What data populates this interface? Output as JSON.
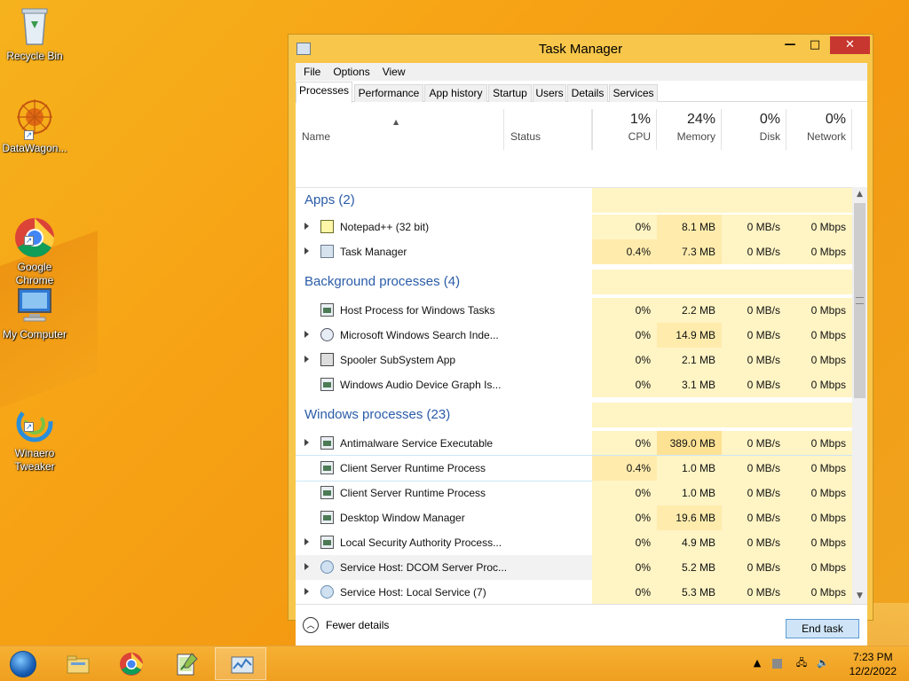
{
  "desktop": {
    "icons": [
      {
        "label": "Recycle Bin",
        "icon": "recycle-bin-icon"
      },
      {
        "label": "DataWagon...",
        "icon": "datawagon-icon"
      },
      {
        "label": "Google\nChrome",
        "icon": "chrome-icon"
      },
      {
        "label": "My Computer",
        "icon": "computer-icon"
      },
      {
        "label": "Winaero\nTweaker",
        "icon": "winaero-icon"
      }
    ]
  },
  "window": {
    "title": "Task Manager",
    "controls": {
      "minimize": "—",
      "maximize": "□",
      "close": "✕"
    },
    "menu": [
      "File",
      "Options",
      "View"
    ],
    "tabs": [
      "Processes",
      "Performance",
      "App history",
      "Startup",
      "Users",
      "Details",
      "Services"
    ],
    "active_tab": "Processes",
    "columns": {
      "name": "Name",
      "status": "Status",
      "cpu": {
        "pct": "1%",
        "label": "CPU"
      },
      "memory": {
        "pct": "24%",
        "label": "Memory"
      },
      "disk": {
        "pct": "0%",
        "label": "Disk"
      },
      "network": {
        "pct": "0%",
        "label": "Network"
      }
    },
    "groups": [
      {
        "title": "Apps (2)",
        "rows": [
          {
            "name": "Notepad++ (32 bit)",
            "cpu": "0%",
            "mem": "8.1 MB",
            "disk": "0 MB/s",
            "net": "0 Mbps",
            "expand": true,
            "icon": "notepad-icon"
          },
          {
            "name": "Task Manager",
            "cpu": "0.4%",
            "mem": "7.3 MB",
            "disk": "0 MB/s",
            "net": "0 Mbps",
            "expand": true,
            "icon": "task-manager-icon"
          }
        ]
      },
      {
        "title": "Background processes (4)",
        "rows": [
          {
            "name": "Host Process for Windows Tasks",
            "cpu": "0%",
            "mem": "2.2 MB",
            "disk": "0 MB/s",
            "net": "0 Mbps",
            "expand": false,
            "icon": "window-icon"
          },
          {
            "name": "Microsoft Windows Search Inde...",
            "cpu": "0%",
            "mem": "14.9 MB",
            "disk": "0 MB/s",
            "net": "0 Mbps",
            "expand": true,
            "icon": "search-icon"
          },
          {
            "name": "Spooler SubSystem App",
            "cpu": "0%",
            "mem": "2.1 MB",
            "disk": "0 MB/s",
            "net": "0 Mbps",
            "expand": true,
            "icon": "printer-icon"
          },
          {
            "name": "Windows Audio Device Graph Is...",
            "cpu": "0%",
            "mem": "3.1 MB",
            "disk": "0 MB/s",
            "net": "0 Mbps",
            "expand": false,
            "icon": "window-icon"
          }
        ]
      },
      {
        "title": "Windows processes (23)",
        "rows": [
          {
            "name": "Antimalware Service Executable",
            "cpu": "0%",
            "mem": "389.0 MB",
            "disk": "0 MB/s",
            "net": "0 Mbps",
            "expand": true,
            "icon": "window-icon"
          },
          {
            "name": "Client Server Runtime Process",
            "cpu": "0.4%",
            "mem": "1.0 MB",
            "disk": "0 MB/s",
            "net": "0 Mbps",
            "expand": false,
            "icon": "window-icon"
          },
          {
            "name": "Client Server Runtime Process",
            "cpu": "0%",
            "mem": "1.0 MB",
            "disk": "0 MB/s",
            "net": "0 Mbps",
            "expand": false,
            "icon": "window-icon"
          },
          {
            "name": "Desktop Window Manager",
            "cpu": "0%",
            "mem": "19.6 MB",
            "disk": "0 MB/s",
            "net": "0 Mbps",
            "expand": false,
            "icon": "window-icon"
          },
          {
            "name": "Local Security Authority Process...",
            "cpu": "0%",
            "mem": "4.9 MB",
            "disk": "0 MB/s",
            "net": "0 Mbps",
            "expand": true,
            "icon": "window-icon"
          },
          {
            "name": "Service Host: DCOM Server Proc...",
            "cpu": "0%",
            "mem": "5.2 MB",
            "disk": "0 MB/s",
            "net": "0 Mbps",
            "expand": true,
            "icon": "gear-icon"
          },
          {
            "name": "Service Host: Local Service (7)",
            "cpu": "0%",
            "mem": "5.3 MB",
            "disk": "0 MB/s",
            "net": "0 Mbps",
            "expand": true,
            "icon": "gear-icon"
          }
        ]
      }
    ],
    "footer": {
      "fewer_details": "Fewer details",
      "end_task": "End task"
    }
  },
  "taskbar": {
    "apps": [
      "file-explorer-icon",
      "chrome-icon",
      "notepad-icon",
      "task-manager-icon"
    ],
    "active_app": "task-manager-icon",
    "time": "7:23 PM",
    "date": "12/2/2022"
  },
  "colors": {
    "accent": "#2a5ca8",
    "heat_light": "#fff4c4",
    "heat_mid": "#ffecad",
    "heat_strong": "#fde294",
    "selection_border": "#cde6f7"
  }
}
